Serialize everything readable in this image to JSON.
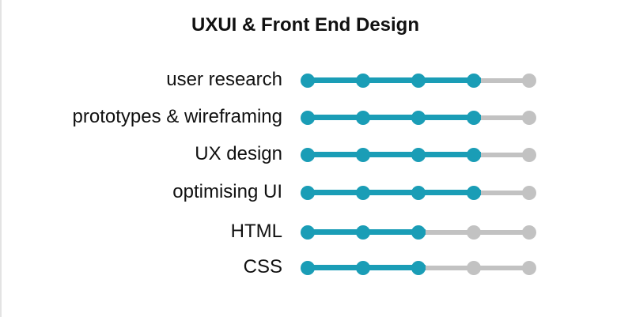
{
  "title": "UXUI & Front End Design",
  "colors": {
    "filled": "#1a9db6",
    "empty": "#c2c2c2"
  },
  "max_level": 5,
  "skills": [
    {
      "label": "user research",
      "level": 4
    },
    {
      "label": "prototypes & wireframing",
      "level": 4
    },
    {
      "label": "UX design",
      "level": 4
    },
    {
      "label": "optimising UI",
      "level": 4
    },
    {
      "label": "HTML",
      "level": 3
    },
    {
      "label": "CSS",
      "level": 3
    }
  ]
}
